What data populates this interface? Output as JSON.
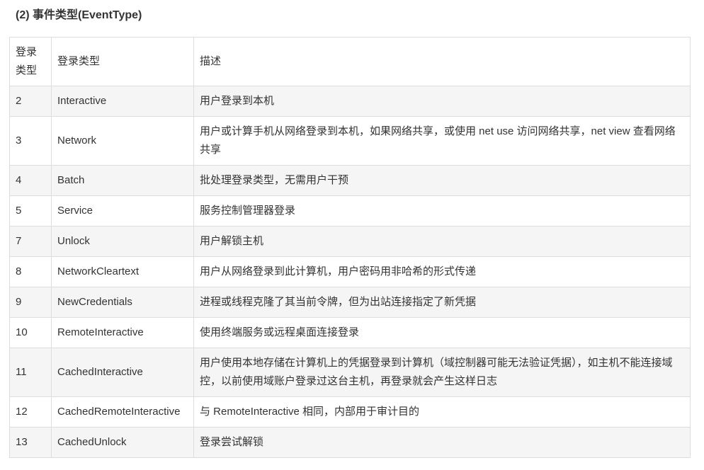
{
  "heading": "(2) 事件类型(EventType)",
  "table": {
    "headers": [
      "登录类型",
      "登录类型",
      "描述"
    ],
    "rows": [
      {
        "id": "2",
        "type": "Interactive",
        "desc": "用户登录到本机"
      },
      {
        "id": "3",
        "type": "Network",
        "desc": "用户或计算手机从网络登录到本机，如果网络共享，或使用 net use 访问网络共享，net view 查看网络共享"
      },
      {
        "id": "4",
        "type": "Batch",
        "desc": "批处理登录类型，无需用户干预"
      },
      {
        "id": "5",
        "type": "Service",
        "desc": "服务控制管理器登录"
      },
      {
        "id": "7",
        "type": "Unlock",
        "desc": "用户解锁主机"
      },
      {
        "id": "8",
        "type": "NetworkCleartext",
        "desc": "用户从网络登录到此计算机，用户密码用非哈希的形式传递"
      },
      {
        "id": "9",
        "type": "NewCredentials",
        "desc": "进程或线程克隆了其当前令牌，但为出站连接指定了新凭据"
      },
      {
        "id": "10",
        "type": "RemoteInteractive",
        "desc": "使用终端服务或远程桌面连接登录"
      },
      {
        "id": "11",
        "type": "CachedInteractive",
        "desc": "用户使用本地存储在计算机上的凭据登录到计算机（域控制器可能无法验证凭据），如主机不能连接域控，以前使用域账户登录过这台主机，再登录就会产生这样日志"
      },
      {
        "id": "12",
        "type": "CachedRemoteInteractive",
        "desc": "与 RemoteInteractive 相同，内部用于审计目的"
      },
      {
        "id": "13",
        "type": "CachedUnlock",
        "desc": "登录尝试解锁"
      }
    ]
  }
}
